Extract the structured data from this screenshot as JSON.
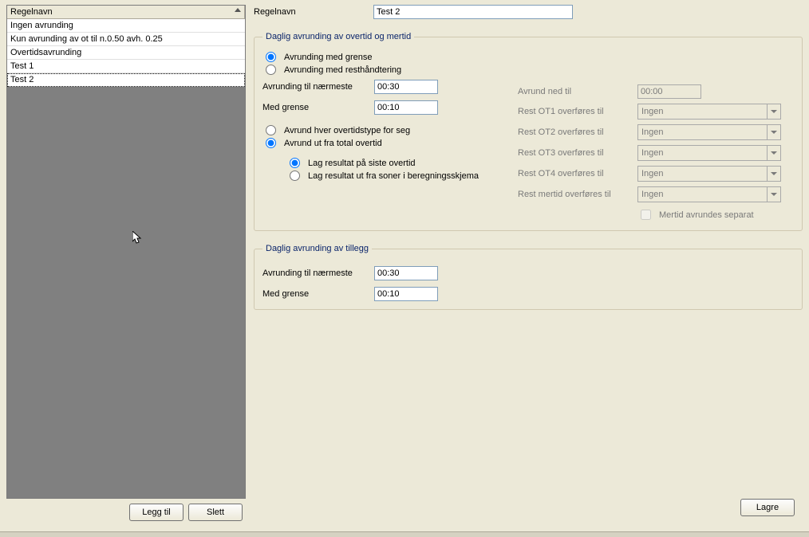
{
  "list": {
    "header": "Regelnavn",
    "items": [
      "Ingen avrunding",
      "Kun avrunding av ot til n.0.50 avh. 0.25",
      "Overtidsavrunding",
      "Test 1",
      "Test 2"
    ],
    "selected_index": 4
  },
  "buttons": {
    "add": "Legg til",
    "delete": "Slett",
    "save": "Lagre"
  },
  "name": {
    "label": "Regelnavn",
    "value": "Test 2"
  },
  "group_overtime": {
    "title": "Daglig avrunding av overtid og mertid",
    "mode": {
      "option_limit": "Avrunding med grense",
      "option_rest": "Avrunding med resthåndtering",
      "selected": "limit"
    },
    "round_nearest": {
      "label": "Avrunding til nærmeste",
      "value": "00:30"
    },
    "with_limit": {
      "label": "Med grense",
      "value": "00:10"
    },
    "scope": {
      "option_each": "Avrund hver overtidstype for seg",
      "option_total": "Avrund ut fra total overtid",
      "selected": "total"
    },
    "result": {
      "option_last": "Lag resultat på siste overtid",
      "option_zones": "Lag resultat ut fra soner i beregningsskjema",
      "selected": "last"
    },
    "right": {
      "round_down": {
        "label": "Avrund ned til",
        "value": "00:00"
      },
      "rest_ot1": {
        "label": "Rest OT1 overføres til",
        "value": "Ingen"
      },
      "rest_ot2": {
        "label": "Rest OT2 overføres til",
        "value": "Ingen"
      },
      "rest_ot3": {
        "label": "Rest OT3 overføres til",
        "value": "Ingen"
      },
      "rest_ot4": {
        "label": "Rest OT4 overføres til",
        "value": "Ingen"
      },
      "rest_mertid": {
        "label": "Rest mertid overføres til",
        "value": "Ingen"
      },
      "mertid_separate": "Mertid avrundes separat"
    }
  },
  "group_addition": {
    "title": "Daglig avrunding av tillegg",
    "round_nearest": {
      "label": "Avrunding til nærmeste",
      "value": "00:30"
    },
    "with_limit": {
      "label": "Med grense",
      "value": "00:10"
    }
  }
}
